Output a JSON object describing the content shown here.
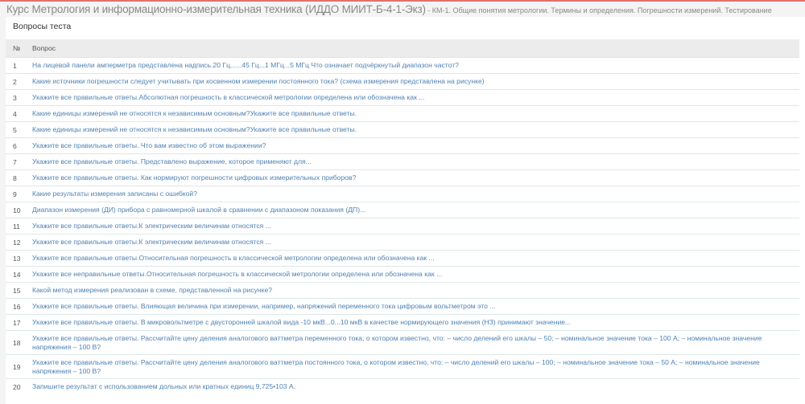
{
  "header": {
    "course": "Курс Метрология и информационно-измерительная техника (ИДДО МИИТ-Б-4-1-Экз)",
    "separator": " - ",
    "subtitle": "КМ-1. Общие понятия метрологии. Термины и определения. Погрешности измерений. Тестирование"
  },
  "panel_title": "Вопросы теста",
  "table": {
    "columns": [
      "№",
      "Вопрос"
    ],
    "rows": [
      {
        "n": "1",
        "q": "На лицевой панели амперметра представлена надпись.20 Гц......45 Гц...1 МГц...5 МГц Что означает подчёркнутый диапазон частот?"
      },
      {
        "n": "2",
        "q": "Какие источники погрешности следует учитывать при косвенном измерении постоянного тока? (схема измерения представлена на рисунке)"
      },
      {
        "n": "3",
        "q": "Укажите все правильные ответы.Абсолютная погрешность в классической метрологии определена или обозначена как ..."
      },
      {
        "n": "4",
        "q": "Какие единицы измерений не относятся к независимым основным?Укажите все правильные ответы."
      },
      {
        "n": "5",
        "q": "Какие единицы измерений не относятся к независимым основным?Укажите все правильные ответы."
      },
      {
        "n": "6",
        "q": "Укажите все правильные ответы. Что вам известно об этом выражении?"
      },
      {
        "n": "7",
        "q": "Укажите все правильные ответы. Представлено выражение, которое применяют для..."
      },
      {
        "n": "8",
        "q": "Укажите все правильные ответы. Как нормируют погрешности цифровых измерительных приборов?"
      },
      {
        "n": "9",
        "q": "Какие результаты измерения записаны с ошибкой?"
      },
      {
        "n": "10",
        "q": "Диапазон измерения (ДИ) прибора с равномерной шкалой в сравнении с диапазоном показания (ДП)..."
      },
      {
        "n": "11",
        "q": "Укажите все правильные ответы.К электрическим величинам относятся ..."
      },
      {
        "n": "12",
        "q": "Укажите все правильные ответы.К электрическим величинам относятся ..."
      },
      {
        "n": "13",
        "q": "Укажите все правильные ответы.Относительная погрешность в классической метрологии определена или обозначена как ..."
      },
      {
        "n": "14",
        "q": "Укажите все неправильные ответы.Относительная погрешность в классической метрологии определена или обозначена как ..."
      },
      {
        "n": "15",
        "q": "Какой метод измерения реализован в схеме, представленной на рисунке?"
      },
      {
        "n": "16",
        "q": "Укажите все правильные ответы. Влияющая величина при измерении, например, напряжений переменного тока цифровым вольтметром это ..."
      },
      {
        "n": "17",
        "q": "Укажите все правильные ответы. В микровольтметре с двусторонней шкалой вида -10 мкВ...0...10 мкВ в качестве нормирующего значения (НЗ) принимают значение..."
      },
      {
        "n": "18",
        "q": "Укажите все правильные ответы. Рассчитайте цену деления аналогового ваттметра переменного тока, о котором известно, что: – число делений его шкалы – 50; – номинальное значение тока – 100 А; – номинальное значение напряжения – 100 В?"
      },
      {
        "n": "19",
        "q": "Укажите все правильные ответы. Рассчитайте цену деления аналогового ваттметра постоянного тока, о котором известно, что: – число делений его шкалы – 100; – номинальное значение тока – 50 А; – номинальное значение напряжения – 100 В?"
      },
      {
        "n": "20",
        "q": "Запишите результат с использованием дольных или кратных единиц 9,725•103 А."
      }
    ]
  }
}
